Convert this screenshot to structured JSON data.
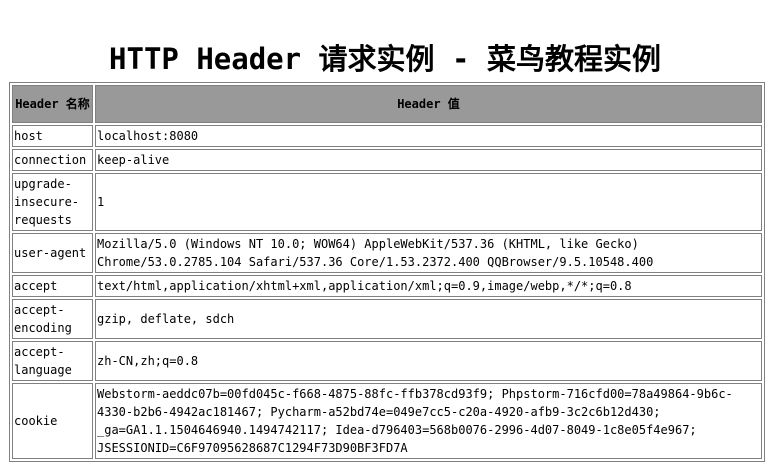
{
  "page": {
    "title": "HTTP Header 请求实例 - 菜鸟教程实例"
  },
  "table": {
    "headers": {
      "name": "Header 名称",
      "value": "Header 值"
    },
    "rows": [
      {
        "name": "host",
        "value": "localhost:8080"
      },
      {
        "name": "connection",
        "value": "keep-alive"
      },
      {
        "name": "upgrade-insecure-requests",
        "value": "1"
      },
      {
        "name": "user-agent",
        "value": "Mozilla/5.0 (Windows NT 10.0; WOW64) AppleWebKit/537.36 (KHTML, like Gecko) Chrome/53.0.2785.104 Safari/537.36 Core/1.53.2372.400 QQBrowser/9.5.10548.400"
      },
      {
        "name": "accept",
        "value": "text/html,application/xhtml+xml,application/xml;q=0.9,image/webp,*/*;q=0.8"
      },
      {
        "name": "accept-encoding",
        "value": "gzip, deflate, sdch"
      },
      {
        "name": "accept-language",
        "value": "zh-CN,zh;q=0.8"
      },
      {
        "name": "cookie",
        "value": "Webstorm-aeddc07b=00fd045c-f668-4875-88fc-ffb378cd93f9; Phpstorm-716cfd00=78a49864-9b6c-4330-b2b6-4942ac181467; Pycharm-a52bd74e=049e7cc5-c20a-4920-afb9-3c2c6b12d430; _ga=GA1.1.1504646940.1494742117; Idea-d796403=568b0076-2996-4d07-8049-1c8e05f4e967; JSESSIONID=C6F97095628687C1294F73D90BF3FD7A"
      }
    ]
  }
}
